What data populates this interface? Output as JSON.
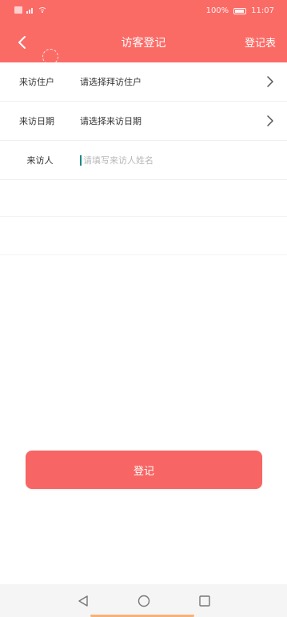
{
  "status_bar": {
    "battery_text": "100%",
    "time": "11:07"
  },
  "header": {
    "title": "访客登记",
    "right_link": "登记表",
    "background_color": "#fb6b66"
  },
  "form": {
    "rows": [
      {
        "label": "来访住户",
        "value": "请选择拜访住户"
      },
      {
        "label": "来访日期",
        "value": "请选择来访日期"
      }
    ],
    "visitor": {
      "label": "来访人",
      "placeholder": "请填写来访人姓名",
      "value": ""
    }
  },
  "submit": {
    "label": "登记",
    "color": "#f76664"
  },
  "icons": {
    "back": "back-arrow-icon",
    "chevron": "chevron-right-icon",
    "nav_back": "triangle-back-icon",
    "nav_home": "circle-home-icon",
    "nav_recent": "square-recent-icon"
  }
}
